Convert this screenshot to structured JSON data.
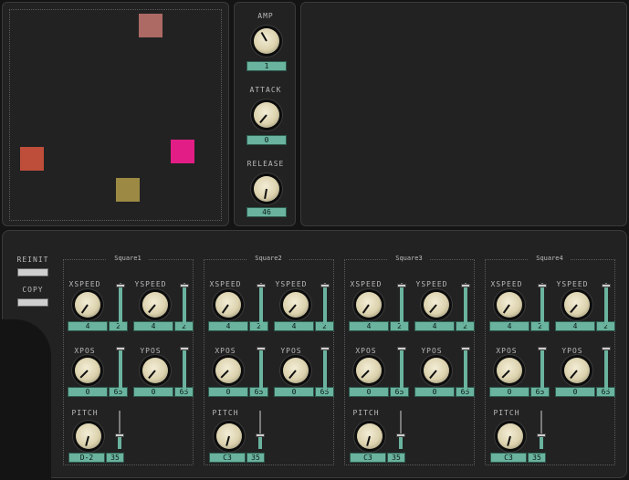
{
  "colors": {
    "square1": "#ad6a64",
    "square2": "#e21e86",
    "square3": "#be4e3a",
    "square4": "#9c8a44",
    "value_box": "#6ab39e"
  },
  "canvas": {
    "squares": [
      {
        "name": "square-1",
        "color": "#ad6a64"
      },
      {
        "name": "square-2",
        "color": "#e21e86"
      },
      {
        "name": "square-3",
        "color": "#be4e3a"
      },
      {
        "name": "square-4",
        "color": "#9c8a44"
      }
    ]
  },
  "envelope": {
    "amp": {
      "label": "AMP",
      "value": "1"
    },
    "attack": {
      "label": "ATTACK",
      "value": "0"
    },
    "release": {
      "label": "RELEASE",
      "value": "46"
    }
  },
  "buttons": {
    "reinit": "REINIT",
    "copy": "COPY"
  },
  "groups": [
    {
      "title": "Square1",
      "xspeed_label": "XSPEED",
      "yspeed_label": "YSPEED",
      "xpos_label": "XPOS",
      "ypos_label": "YPOS",
      "pitch_label": "PITCH",
      "xspeed": "4",
      "xspeed_slider": "2",
      "yspeed": "4",
      "yspeed_slider": "2",
      "xpos": "0",
      "xpos_slider": "65",
      "ypos": "0",
      "ypos_slider": "65",
      "pitch": "D-2",
      "pitch_slider": "35"
    },
    {
      "title": "Square2",
      "xspeed_label": "XSPEED",
      "yspeed_label": "YSPEED",
      "xpos_label": "XPOS",
      "ypos_label": "YPOS",
      "pitch_label": "PITCH",
      "xspeed": "4",
      "xspeed_slider": "2",
      "yspeed": "4",
      "yspeed_slider": "2",
      "xpos": "0",
      "xpos_slider": "65",
      "ypos": "0",
      "ypos_slider": "65",
      "pitch": "C3",
      "pitch_slider": "35"
    },
    {
      "title": "Square3",
      "xspeed_label": "XSPEED",
      "yspeed_label": "YSPEED",
      "xpos_label": "XPOS",
      "ypos_label": "YPOS",
      "pitch_label": "PITCH",
      "xspeed": "4",
      "xspeed_slider": "2",
      "yspeed": "4",
      "yspeed_slider": "2",
      "xpos": "0",
      "xpos_slider": "65",
      "ypos": "0",
      "ypos_slider": "65",
      "pitch": "C3",
      "pitch_slider": "35"
    },
    {
      "title": "Square4",
      "xspeed_label": "XSPEED",
      "yspeed_label": "YSPEED",
      "xpos_label": "XPOS",
      "ypos_label": "YPOS",
      "pitch_label": "PITCH",
      "xspeed": "4",
      "xspeed_slider": "2",
      "yspeed": "4",
      "yspeed_slider": "2",
      "xpos": "0",
      "xpos_slider": "65",
      "ypos": "0",
      "ypos_slider": "65",
      "pitch": "C3",
      "pitch_slider": "35"
    }
  ]
}
